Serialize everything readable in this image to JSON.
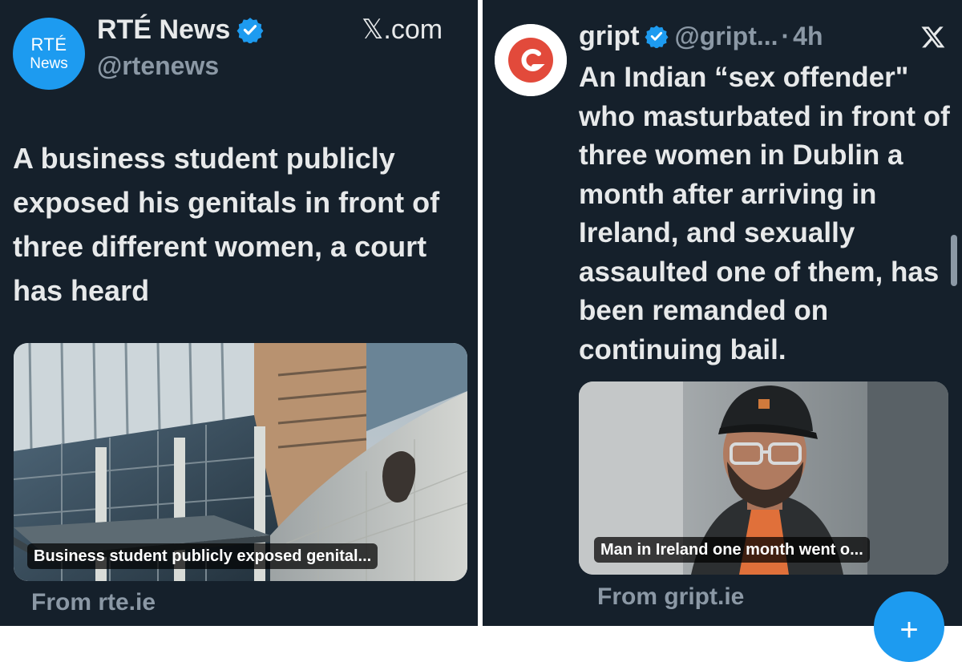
{
  "rte_tweet": {
    "avatar_line1": "RTÉ",
    "avatar_line2": "News",
    "display_name": "RTÉ News",
    "handle": "@rtenews",
    "site_label": "𝕏.com",
    "text": "A business student publicly exposed his genitals in front of three different women, a court has heard",
    "card_caption": "Business student publicly exposed genital...",
    "card_source": "From rte.ie"
  },
  "gript_tweet": {
    "display_name": "gript",
    "handle": "@gript...",
    "separator": "·",
    "time": "4h",
    "text": "An Indian “sex offender\" who masturbated in front of three women in Dublin a month after arriving in Ireland, and sexually assaulted one of them, has been remanded on continuing bail.",
    "card_caption": "Man in Ireland one month went o...",
    "card_source": "From gript.ie"
  },
  "icons": {
    "verified": "verified-badge-icon",
    "x_logo": "x-logo-icon",
    "compose": "compose-plus-icon"
  },
  "fab": {
    "symbol": "+"
  },
  "colors": {
    "background": "#15202b",
    "text": "#e7e9ea",
    "secondary": "#8b98a5",
    "accent": "#1d9bf0"
  }
}
